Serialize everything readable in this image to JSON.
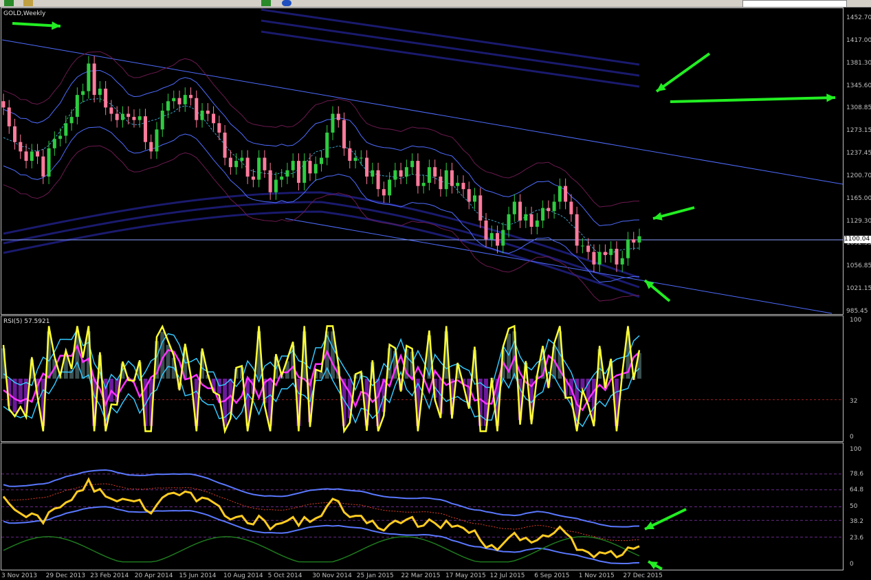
{
  "app": {
    "symbol_title": "GOLD,Weekly"
  },
  "colors": {
    "bull": "#2ecc40",
    "bear": "#ff7b9c",
    "channel": "#4f6dff",
    "bands_dark": "#1a1a6e",
    "bollinger": "#4f6dff",
    "middle": "#6b1a4f",
    "rsi_line": "#ffff33",
    "rsi_ma": "#ff33ff",
    "hist_pos": "#3b5050",
    "hist_neg": "#6a1a9a",
    "stoch_line": "#ffcc22",
    "dark_green": "#1f7a1f",
    "arrow": "#22ee22"
  },
  "price_axis": [
    "1452.70",
    "1417.00",
    "1381.30",
    "1345.60",
    "1308.85",
    "1273.15",
    "1237.45",
    "1200.70",
    "1165.00",
    "1129.30",
    "1092.55",
    "1056.85",
    "1021.15",
    "985.45"
  ],
  "current_price": "1100.04",
  "rsi": {
    "label": "RSI(5) 57.5921",
    "axis": [
      "100",
      "32",
      "0"
    ]
  },
  "osc": {
    "axis": [
      "100",
      "78.6",
      "64.8",
      "50",
      "38.2",
      "23.6",
      "0"
    ]
  },
  "dates": [
    "3 Nov 2013",
    "29 Dec 2013",
    "23 Feb 2014",
    "20 Apr 2014",
    "15 Jun 2014",
    "10 Aug 2014",
    "5 Oct 2014",
    "30 Nov 2014",
    "25 Jan 2015",
    "22 Mar 2015",
    "17 May 2015",
    "12 Jul 2015",
    "6 Sep 2015",
    "1 Nov 2015",
    "27 Dec 2015"
  ],
  "chart_data": {
    "type": "candlestick",
    "title": "GOLD,Weekly",
    "ylim": [
      985.45,
      1452.7
    ],
    "closes": [
      1310,
      1280,
      1255,
      1240,
      1225,
      1240,
      1232,
      1200,
      1245,
      1260,
      1265,
      1285,
      1295,
      1330,
      1336,
      1380,
      1330,
      1340,
      1310,
      1300,
      1290,
      1300,
      1295,
      1290,
      1296,
      1255,
      1240,
      1275,
      1305,
      1320,
      1325,
      1315,
      1330,
      1325,
      1290,
      1305,
      1300,
      1285,
      1270,
      1230,
      1215,
      1225,
      1230,
      1200,
      1195,
      1230,
      1210,
      1175,
      1195,
      1200,
      1210,
      1225,
      1190,
      1225,
      1205,
      1220,
      1230,
      1270,
      1300,
      1290,
      1245,
      1225,
      1230,
      1230,
      1200,
      1210,
      1180,
      1170,
      1195,
      1210,
      1200,
      1215,
      1225,
      1185,
      1190,
      1215,
      1200,
      1180,
      1210,
      1185,
      1190,
      1180,
      1160,
      1170,
      1130,
      1100,
      1110,
      1090,
      1115,
      1140,
      1160,
      1130,
      1140,
      1120,
      1130,
      1150,
      1145,
      1160,
      1185,
      1160,
      1140,
      1090,
      1090,
      1080,
      1060,
      1080,
      1075,
      1085,
      1060,
      1070,
      1100,
      1095,
      1105
    ]
  }
}
